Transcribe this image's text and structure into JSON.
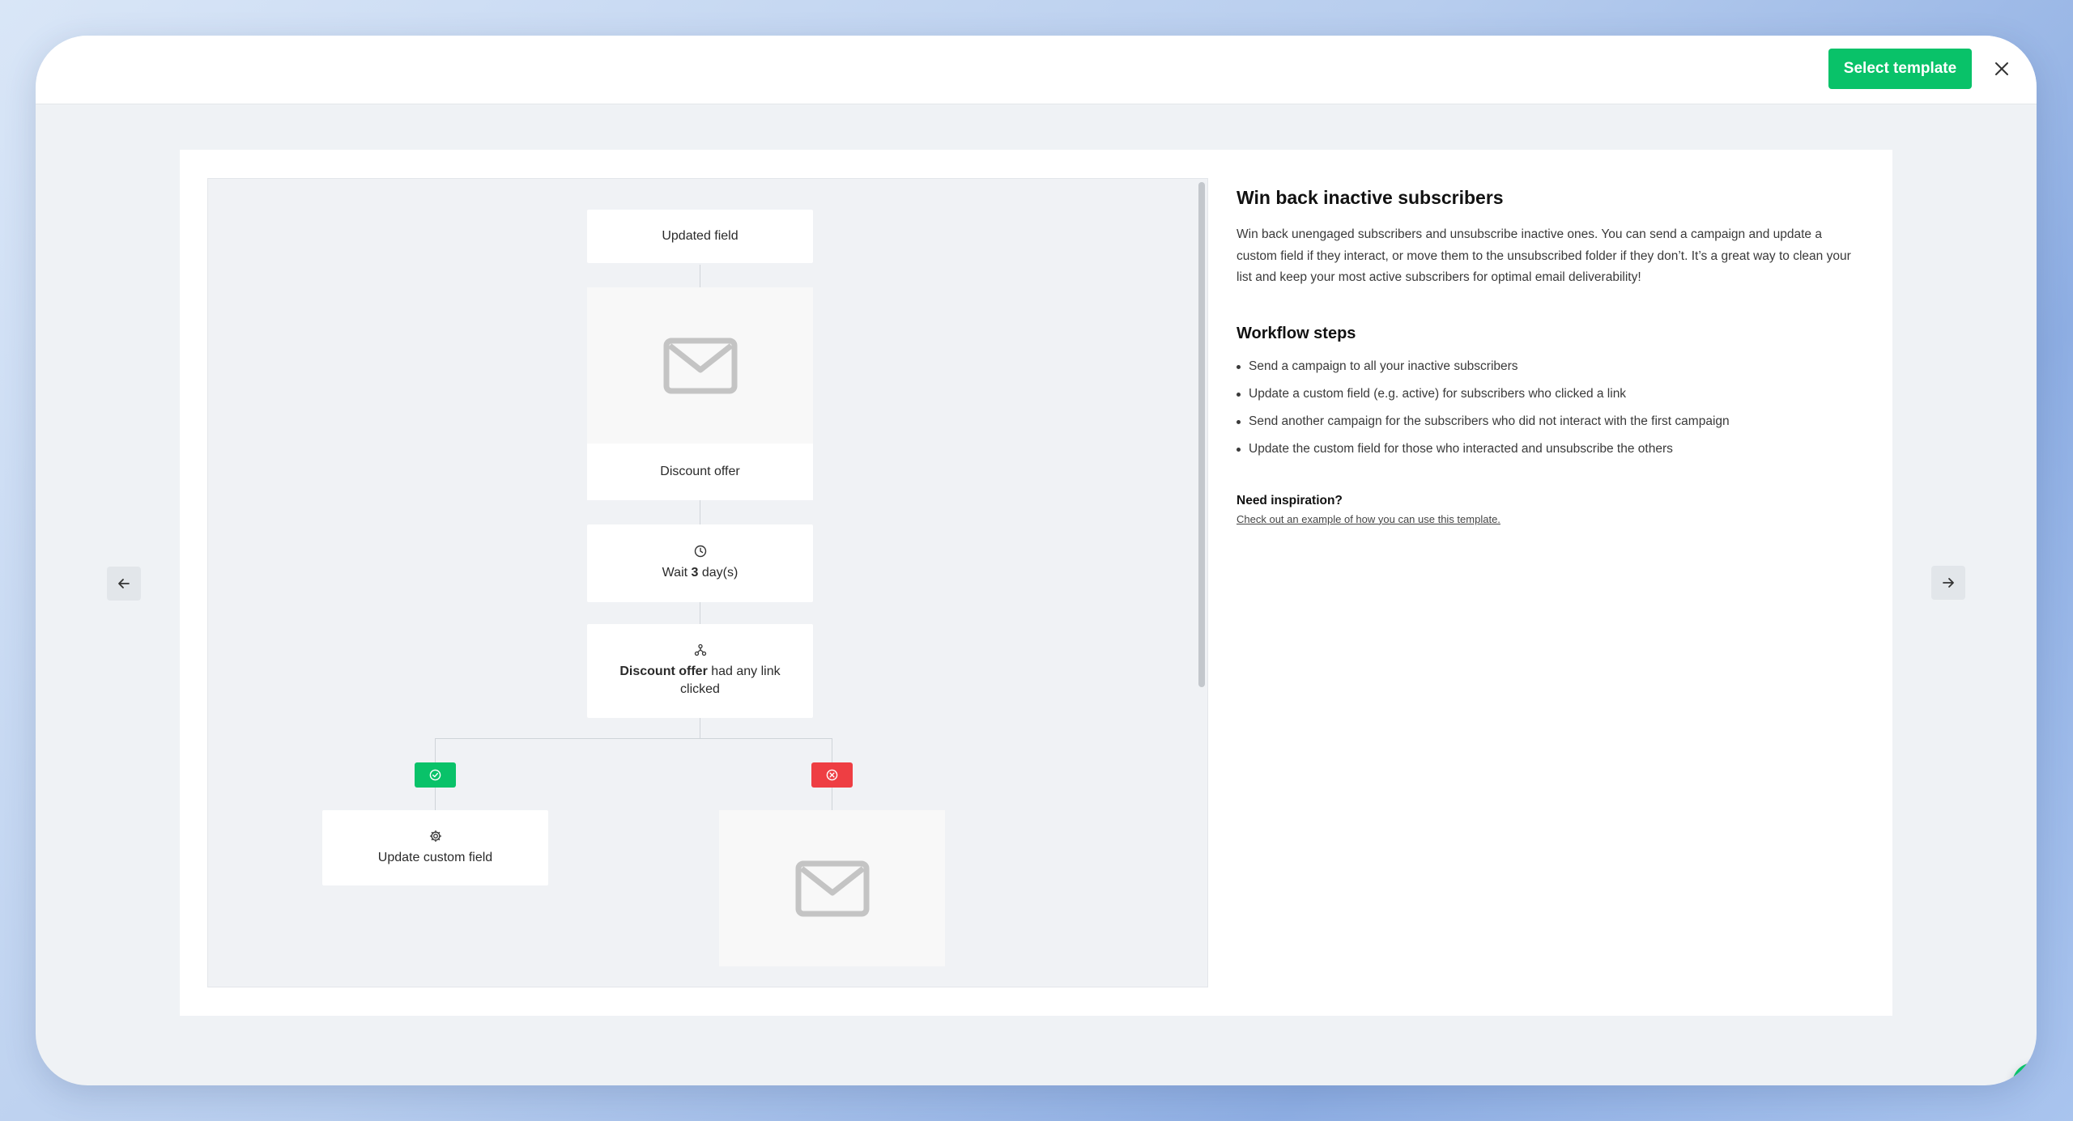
{
  "header": {
    "select_button": "Select template",
    "close_icon": "close-icon"
  },
  "navigation": {
    "prev_icon": "arrow-left-icon",
    "next_icon": "arrow-right-icon"
  },
  "workflow": {
    "trigger": "Updated field",
    "email_1": "Discount offer",
    "wait": {
      "prefix": "Wait ",
      "amount": "3",
      "suffix": " day(s)",
      "icon": "clock-icon"
    },
    "condition": {
      "campaign": "Discount offer",
      "text": " had any link clicked",
      "icon": "split-icon"
    },
    "yes_badge_icon": "check-circle-icon",
    "no_badge_icon": "x-circle-icon",
    "yes_action": {
      "label": "Update custom field",
      "icon": "gear-icon"
    },
    "email_icon": "envelope-icon"
  },
  "info": {
    "title": "Win back inactive subscribers",
    "description": "Win back unengaged subscribers and unsubscribe inactive ones. You can send a campaign and update a custom field if they interact, or move them to the unsubscribed folder if they don’t. It’s a great way to clean your list and keep your most active subscribers for optimal email deliverability!",
    "steps_title": "Workflow steps",
    "steps": [
      "Send a campaign to all your inactive subscribers",
      "Update a custom field (e.g. active) for subscribers who clicked a link",
      "Send another campaign for the subscribers who did not interact with the first campaign",
      "Update the custom field for those who interacted and unsubscribe the others"
    ],
    "inspiration_title": "Need inspiration?",
    "inspiration_link": "Check out an example of how you can use this template."
  },
  "colors": {
    "brand_green": "#09c269",
    "danger_red": "#ee3e43"
  },
  "chat": {
    "icon": "chat-icon"
  }
}
